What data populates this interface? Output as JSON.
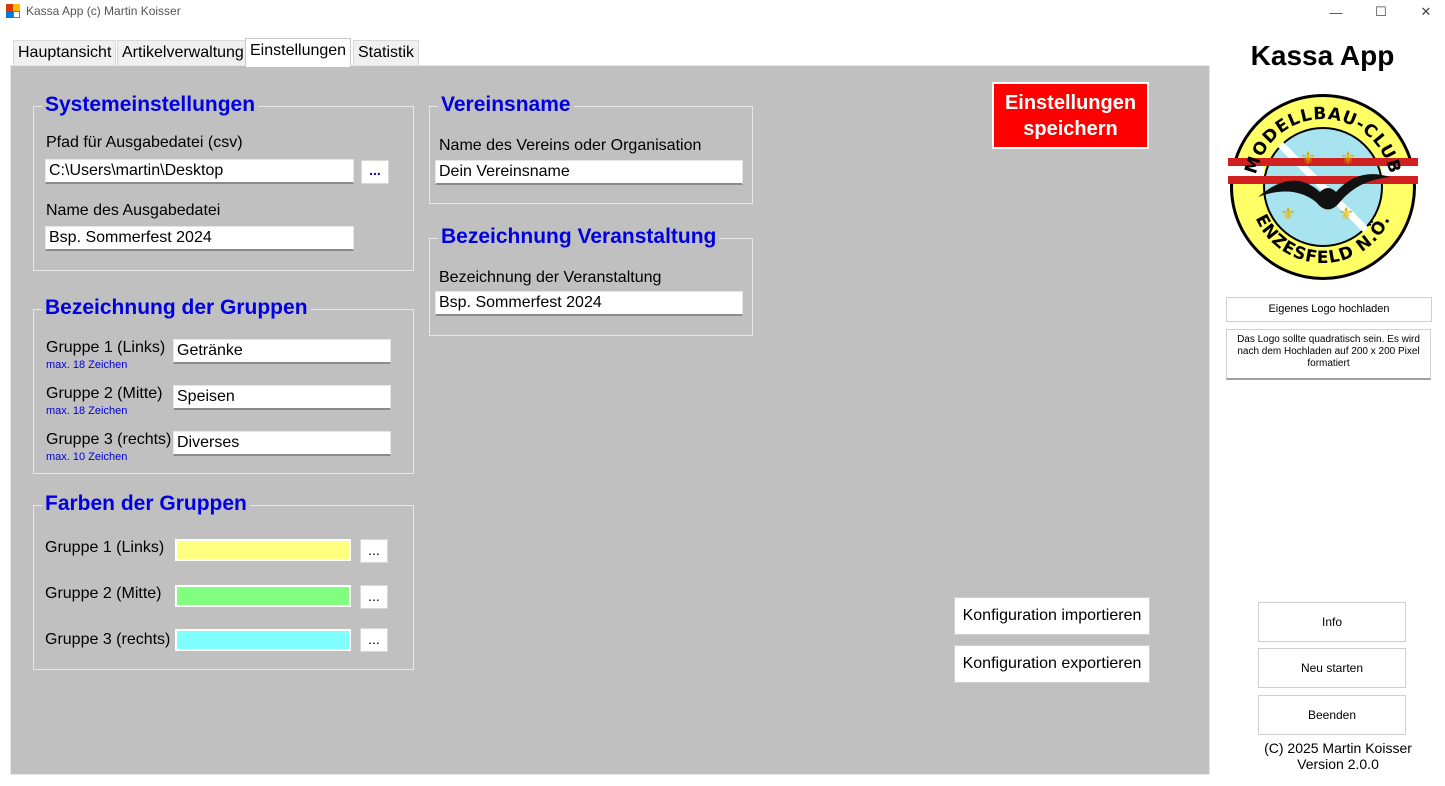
{
  "window": {
    "title": "Kassa App (c) Martin Koisser",
    "minimize_glyph": "—",
    "maximize_glyph": "☐",
    "close_glyph": "✕"
  },
  "tabs": [
    {
      "label": "Hauptansicht",
      "active": false
    },
    {
      "label": "Artikelverwaltung",
      "active": false
    },
    {
      "label": "Einstellungen",
      "active": true
    },
    {
      "label": "Statistik",
      "active": false
    }
  ],
  "system": {
    "title": "Systemeinstellungen",
    "path_label": "Pfad für Ausgabedatei (csv)",
    "path_value": "C:\\Users\\martin\\Desktop",
    "browse_label": "...",
    "filename_label": "Name des Ausgabedatei",
    "filename_value": "Bsp. Sommerfest 2024"
  },
  "groups": {
    "title": "Bezeichnung der Gruppen",
    "items": [
      {
        "label": "Gruppe 1 (Links)",
        "hint": "max. 18 Zeichen",
        "value": "Getränke"
      },
      {
        "label": "Gruppe 2 (Mitte)",
        "hint": "max. 18 Zeichen",
        "value": "Speisen"
      },
      {
        "label": "Gruppe 3 (rechts)",
        "hint": "max. 10 Zeichen",
        "value": "Diverses"
      }
    ]
  },
  "colors": {
    "title": "Farben der Gruppen",
    "items": [
      {
        "label": "Gruppe 1 (Links)",
        "color": "#ffff80",
        "button": "..."
      },
      {
        "label": "Gruppe 2 (Mitte)",
        "color": "#80ff80",
        "button": "..."
      },
      {
        "label": "Gruppe 3 (rechts)",
        "color": "#80ffff",
        "button": "..."
      }
    ]
  },
  "club": {
    "title": "Vereinsname",
    "label": "Name des Vereins oder Organisation",
    "value": "Dein Vereinsname"
  },
  "event": {
    "title": "Bezeichnung Veranstaltung",
    "label": "Bezeichnung der Veranstaltung",
    "value": "Bsp. Sommerfest 2024"
  },
  "actions": {
    "save_line1": "Einstellungen",
    "save_line2": "speichern",
    "import_label": "Konfiguration importieren",
    "export_label": "Konfiguration exportieren"
  },
  "sidebar": {
    "app_title": "Kassa App",
    "logo_text_top": "MODELLBAU-CLUB",
    "logo_text_bottom": "ENZESFELD N.Ö.",
    "upload_label": "Eigenes Logo hochladen",
    "upload_note": "Das Logo sollte quadratisch sein. Es wird nach dem Hochladen auf 200 x 200 Pixel formatiert",
    "info_label": "Info",
    "restart_label": "Neu starten",
    "exit_label": "Beenden",
    "copyright": "(C) 2025 Martin Koisser",
    "version": "Version 2.0.0"
  },
  "theme": {
    "panel": "#c0c0c0",
    "heading": "#0000e0",
    "save_button": "#ff0000",
    "logo_ring": "#ffff66",
    "logo_inner": "#a8e4f0",
    "logo_stripe": "#d02020"
  }
}
